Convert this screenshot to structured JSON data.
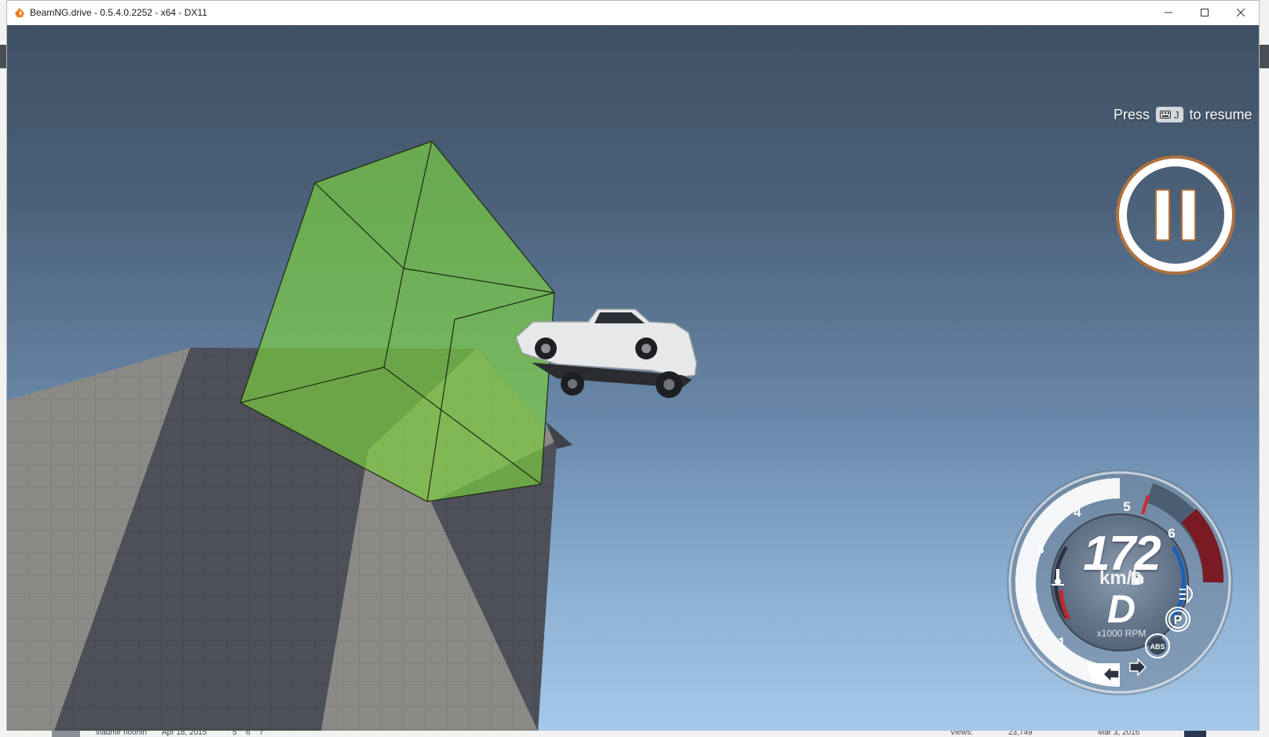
{
  "window": {
    "title": "BeamNG.drive - 0.5.4.0.2252 - x64 - DX11",
    "controls": [
      "minimize",
      "maximize",
      "close"
    ]
  },
  "pause_overlay": {
    "press_label": "Press",
    "key_icon": "keyboard-icon",
    "key_label": "J",
    "resume_label": "to resume",
    "pause_icon": "pause-icon"
  },
  "dashboard": {
    "speed": "172",
    "speed_unit": "km/h",
    "gear": "D",
    "rpm_unit": "x1000 RPM",
    "rpm_ticks": [
      "1",
      "2",
      "3",
      "4",
      "5",
      "6"
    ],
    "indicators": {
      "temperature_icon": "coolant-temp-icon",
      "fuel_icon": "fuel-icon",
      "headlight_icon": "headlight-icon",
      "parking_brake": "P",
      "abs": "ABS",
      "left_signal_icon": "left-arrow-icon",
      "right_signal_icon": "right-arrow-icon"
    },
    "colors": {
      "redline": "#7a1a22",
      "temp_gauge": "#c1272d",
      "fuel_gauge": "#1d5fb8",
      "accent": "#c08040"
    }
  },
  "background_page": {
    "author": "vladmir noonin",
    "date": "Apr 18, 2015",
    "pages": [
      "5",
      "6",
      "7"
    ],
    "views_label": "Views:",
    "views_value": "23,749",
    "last_date": "Mar 3, 2016"
  }
}
